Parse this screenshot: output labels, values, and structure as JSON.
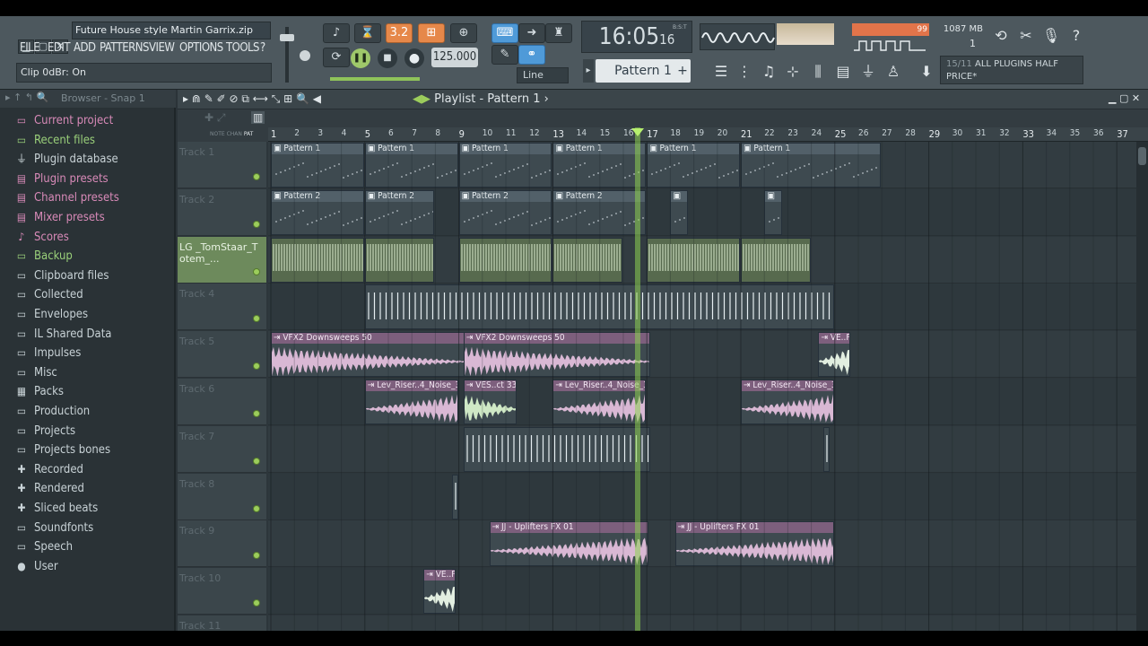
{
  "window": {
    "title": "Future House style Martin Garrix.zip"
  },
  "menu": [
    "FILE",
    "EDIT",
    "ADD",
    "PATTERNS",
    "VIEW",
    "OPTIONS",
    "TOOLS",
    "?"
  ],
  "hint": "Clip 0dBr: On",
  "transport": {
    "snap_value": "3.2",
    "tempo": "125.000",
    "line_mode": "Line"
  },
  "time": {
    "main": "16:05",
    "sub": "16",
    "unit": "B:S:T"
  },
  "pattern_selector": "Pattern 1",
  "cpu": {
    "value": "99",
    "memory": "1087 MB",
    "polyphony": "1"
  },
  "news": {
    "count": "15/11",
    "text": "ALL PLUGINS HALF PRICE*"
  },
  "browser": {
    "title": "Browser - Snap 1",
    "items": [
      {
        "label": "Current project",
        "icon": "folder-icon",
        "style": "pink"
      },
      {
        "label": "Recent files",
        "icon": "folder-icon",
        "style": "green"
      },
      {
        "label": "Plugin database",
        "icon": "plug-icon",
        "style": "norm"
      },
      {
        "label": "Plugin presets",
        "icon": "preset-icon",
        "style": "pink"
      },
      {
        "label": "Channel presets",
        "icon": "preset-icon",
        "style": "pink"
      },
      {
        "label": "Mixer presets",
        "icon": "preset-icon",
        "style": "pink"
      },
      {
        "label": "Scores",
        "icon": "note-icon",
        "style": "pink"
      },
      {
        "label": "Backup",
        "icon": "folder-icon",
        "style": "green"
      },
      {
        "label": "Clipboard files",
        "icon": "folder-icon",
        "style": "norm"
      },
      {
        "label": "Collected",
        "icon": "folder-icon",
        "style": "norm"
      },
      {
        "label": "Envelopes",
        "icon": "folder-icon",
        "style": "norm"
      },
      {
        "label": "IL Shared Data",
        "icon": "folder-icon",
        "style": "norm"
      },
      {
        "label": "Impulses",
        "icon": "folder-icon",
        "style": "norm"
      },
      {
        "label": "Misc",
        "icon": "folder-icon",
        "style": "norm"
      },
      {
        "label": "Packs",
        "icon": "packs-icon",
        "style": "norm"
      },
      {
        "label": "Production",
        "icon": "folder-icon",
        "style": "norm"
      },
      {
        "label": "Projects",
        "icon": "folder-icon",
        "style": "norm"
      },
      {
        "label": "Projects bones",
        "icon": "folder-icon",
        "style": "norm"
      },
      {
        "label": "Recorded",
        "icon": "plus-icon",
        "style": "norm"
      },
      {
        "label": "Rendered",
        "icon": "plus-icon",
        "style": "norm"
      },
      {
        "label": "Sliced beats",
        "icon": "plus-icon",
        "style": "norm"
      },
      {
        "label": "Soundfonts",
        "icon": "folder-icon",
        "style": "norm"
      },
      {
        "label": "Speech",
        "icon": "folder-icon",
        "style": "norm"
      },
      {
        "label": "User",
        "icon": "user-icon",
        "style": "norm"
      }
    ]
  },
  "playlist": {
    "title": "Playlist - Pattern 1",
    "header_labels": [
      "NOTE",
      "CHAN",
      "PAT"
    ],
    "ruler": [
      "1",
      "2",
      "3",
      "4",
      "5",
      "6",
      "7",
      "8",
      "9",
      "10",
      "11",
      "12",
      "13",
      "14",
      "15",
      "16",
      "17",
      "18",
      "19",
      "20",
      "21",
      "22",
      "23",
      "24",
      "25",
      "26",
      "27",
      "28",
      "29",
      "30",
      "31",
      "32",
      "33",
      "34",
      "35",
      "36",
      "37"
    ],
    "playhead_bar": 16.6,
    "tracks": [
      {
        "name": "Track 1",
        "clips": [
          {
            "label": "Pattern 1",
            "start": 1,
            "len": 4,
            "type": "pat"
          },
          {
            "label": "Pattern 1",
            "start": 5,
            "len": 4,
            "type": "pat"
          },
          {
            "label": "Pattern 1",
            "start": 9,
            "len": 4,
            "type": "pat"
          },
          {
            "label": "Pattern 1",
            "start": 13,
            "len": 4,
            "type": "pat"
          },
          {
            "label": "Pattern 1",
            "start": 17,
            "len": 4,
            "type": "pat"
          },
          {
            "label": "Pattern 1",
            "start": 21,
            "len": 6,
            "type": "pat"
          }
        ]
      },
      {
        "name": "Track 2",
        "clips": [
          {
            "label": "Pattern 2",
            "start": 1,
            "len": 4,
            "type": "pat"
          },
          {
            "label": "Pattern 2",
            "start": 5,
            "len": 3,
            "type": "pat"
          },
          {
            "label": "Pattern 2",
            "start": 9,
            "len": 4,
            "type": "pat"
          },
          {
            "label": "Pattern 2",
            "start": 13,
            "len": 4,
            "type": "pat"
          },
          {
            "label": "",
            "start": 18,
            "len": 0.8,
            "type": "pat"
          },
          {
            "label": "",
            "start": 22,
            "len": 0.8,
            "type": "pat"
          }
        ]
      },
      {
        "name": "LG _TomStaar_Totem_...",
        "clips": [
          {
            "label": "",
            "start": 1,
            "len": 4,
            "type": "drm"
          },
          {
            "label": "",
            "start": 5,
            "len": 3,
            "type": "drm"
          },
          {
            "label": "",
            "start": 9,
            "len": 4,
            "type": "drm"
          },
          {
            "label": "",
            "start": 13,
            "len": 3,
            "type": "drm"
          },
          {
            "label": "",
            "start": 17,
            "len": 4,
            "type": "drm"
          },
          {
            "label": "",
            "start": 21,
            "len": 3,
            "type": "drm"
          }
        ]
      },
      {
        "name": "Track 4",
        "clips": [
          {
            "label": "",
            "start": 5,
            "len": 20,
            "type": "hit"
          }
        ]
      },
      {
        "name": "Track 5",
        "clips": [
          {
            "label": "VFX2 Downsweeps 50",
            "start": 1,
            "len": 8.3,
            "type": "aud"
          },
          {
            "label": "VFX2 Downsweeps 50",
            "start": 9.2,
            "len": 8,
            "type": "aud"
          },
          {
            "label": "VE..F",
            "start": 24.3,
            "len": 1.4,
            "type": "aud"
          }
        ]
      },
      {
        "name": "Track 6",
        "clips": [
          {
            "label": "Lev_Riser..4_Noise_3",
            "start": 5,
            "len": 4,
            "type": "aud"
          },
          {
            "label": "VES..ct 33",
            "start": 9.2,
            "len": 2.3,
            "type": "aud"
          },
          {
            "label": "Lev_Riser..4_Noise_3",
            "start": 13,
            "len": 4,
            "type": "aud"
          },
          {
            "label": "Lev_Riser..4_Noise_3",
            "start": 21,
            "len": 4,
            "type": "aud"
          }
        ]
      },
      {
        "name": "Track 7",
        "clips": [
          {
            "label": "",
            "start": 9.2,
            "len": 8,
            "type": "hit"
          },
          {
            "label": "",
            "start": 24.5,
            "len": 0.3,
            "type": "hit"
          }
        ]
      },
      {
        "name": "Track 8",
        "clips": [
          {
            "label": "",
            "start": 8.7,
            "len": 0.3,
            "type": "hit"
          }
        ]
      },
      {
        "name": "Track 9",
        "clips": [
          {
            "label": "JJ - Uplifters FX 01",
            "start": 10.3,
            "len": 6.8,
            "type": "aud"
          },
          {
            "label": "JJ - Uplifters FX 01",
            "start": 18.2,
            "len": 6.8,
            "type": "aud"
          }
        ]
      },
      {
        "name": "Track 10",
        "clips": [
          {
            "label": "VE..F",
            "start": 7.5,
            "len": 1.4,
            "type": "aud"
          }
        ]
      },
      {
        "name": "Track 11",
        "clips": []
      }
    ]
  }
}
